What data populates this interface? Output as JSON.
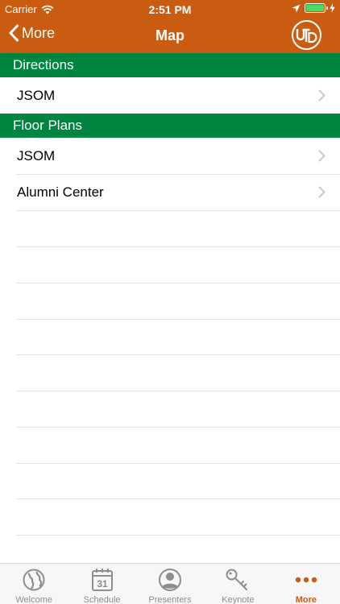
{
  "colors": {
    "brand": "#c95c10",
    "section": "#008540"
  },
  "status_bar": {
    "carrier": "Carrier",
    "time": "2:51 PM"
  },
  "nav": {
    "back_label": "More",
    "title": "Map"
  },
  "sections": [
    {
      "title": "Directions",
      "items": [
        {
          "label": "JSOM"
        }
      ]
    },
    {
      "title": "Floor Plans",
      "items": [
        {
          "label": "JSOM"
        },
        {
          "label": "Alumni Center"
        }
      ]
    }
  ],
  "tabs": [
    {
      "label": "Welcome",
      "icon": "globe-icon"
    },
    {
      "label": "Schedule",
      "icon": "calendar-icon",
      "icon_text": "31"
    },
    {
      "label": "Presenters",
      "icon": "person-icon"
    },
    {
      "label": "Keynote",
      "icon": "key-icon"
    },
    {
      "label": "More",
      "icon": "more-icon",
      "active": true
    }
  ]
}
